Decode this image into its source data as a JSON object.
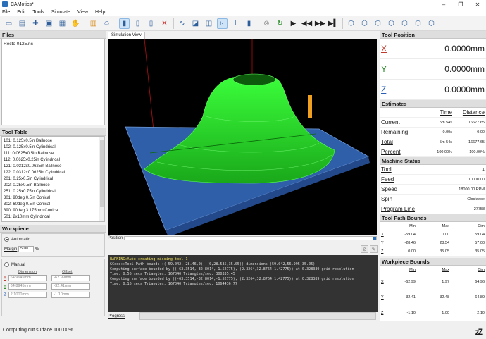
{
  "window": {
    "title": "CAMotics*",
    "controls": [
      "–",
      "❐",
      "✕"
    ]
  },
  "menu": [
    "File",
    "Edit",
    "Tools",
    "Simulate",
    "View",
    "Help"
  ],
  "toolbar": {
    "icons": [
      "new-file",
      "open-file",
      "add",
      "save",
      "export",
      "handshake",
      "tool",
      "user",
      "view-mode-1",
      "view-mode-2",
      "view-mode-3",
      "clear",
      "path",
      "surface",
      "workpiece",
      "axes",
      "tool-display",
      "stop",
      "reload",
      "play",
      "rewind",
      "fast-forward",
      "skip",
      "view-iso",
      "view-front",
      "view-top",
      "view-right",
      "view-back",
      "view-left",
      "view-bottom"
    ]
  },
  "files": {
    "title": "Files",
    "items": [
      "Recto 0125.nc"
    ]
  },
  "tool_table": {
    "title": "Tool Table",
    "items": [
      "101: 0.125x0.5in Ballnose",
      "102: 0.125x0.5in Cylindrical",
      "111: 0.0625x0.5in Ballnose",
      "112: 0.0625x0.25in Cylindrical",
      "121: 0.0312x0.0625in Ballnose",
      "122: 0.0312x0.0625in Cylindrical",
      "201: 0.25x0.5in Cylindrical",
      "202: 0.25x0.5in Ballnose",
      "251: 0.25x0.75in Cylindrical",
      "301: 90deg 0.5in Conical",
      "302: 60deg 0.5in Conical",
      "390: 90deg 3.175mm Conical",
      "501: 2x10mm Cylindrical"
    ]
  },
  "workpiece": {
    "title": "Workpiece",
    "automatic_label": "Automatic",
    "margin_label": "Margin",
    "margin_value": "5.00",
    "margin_unit": "%",
    "manual_label": "Manual",
    "dimension_label": "Dimension",
    "offset_label": "Offset",
    "rows": [
      {
        "axis": "X",
        "dimension": "64.9649mm",
        "offset": "-62.99mm"
      },
      {
        "axis": "Y",
        "dimension": "64.8945mm",
        "offset": "-32.41mm"
      },
      {
        "axis": "Z",
        "dimension": "2.1000mm",
        "offset": "-1.10mm"
      }
    ]
  },
  "simulation": {
    "tab_label": "Simulation View",
    "position_label": "Position"
  },
  "console": {
    "lines": [
      {
        "text": "WARNING:Auto-creating missing tool 1",
        "type": "warn"
      },
      {
        "text": "GCode::Tool Path bounds ((-59.042,-28.46,0), (0,28.535,35.05)) dimensions (59.042,56.995,35.05)",
        "type": "info"
      },
      {
        "text": "Computing surface bounded by ((-63.3514,-32.8014,-1.52775), (2.3264,32.8764,1.42775)) at 0.328389 grid resolution",
        "type": "info"
      },
      {
        "text": "Time: 0.56 secs Triangles: 167040 Triangles/sec: 300335.45",
        "type": "info"
      },
      {
        "text": "Computing surface bounded by ((-63.3514,-32.8014,-1.52775), (2.3264,32.8764,1.42775)) at 0.328389 grid resolution",
        "type": "info"
      },
      {
        "text": "Time: 0.16 secs Triangles: 167040 Triangles/sec: 1064436.77",
        "type": "info"
      }
    ]
  },
  "progress_label": "Progress",
  "status": {
    "text": "Computing cut surface 100.00%",
    "sleep_glyph": "zZ"
  },
  "tool_position": {
    "title": "Tool Position",
    "rows": [
      {
        "axis": "X",
        "value": "0.0000mm"
      },
      {
        "axis": "Y",
        "value": "0.0000mm"
      },
      {
        "axis": "Z",
        "value": "0.0000mm"
      }
    ]
  },
  "estimates": {
    "title": "Estimates",
    "col_time": "Time",
    "col_distance": "Distance",
    "rows": [
      {
        "label": "Current",
        "time": "5m 54s",
        "distance": "16677.65"
      },
      {
        "label": "Remaining",
        "time": "0.00s",
        "distance": "0.00"
      },
      {
        "label": "Total",
        "time": "5m 54s",
        "distance": "16677.65"
      },
      {
        "label": "Percent",
        "time": "100.00%",
        "distance": "100.00%"
      }
    ]
  },
  "machine_status": {
    "title": "Machine Status",
    "rows": [
      {
        "label": "Tool",
        "value": "1"
      },
      {
        "label": "Feed",
        "value": "10000.00"
      },
      {
        "label": "Speed",
        "value": "18000.00 RPM"
      },
      {
        "label": "Spin",
        "value": "Clockwise"
      },
      {
        "label": "Program Line",
        "value": "27758"
      }
    ]
  },
  "tool_path_bounds": {
    "title": "Tool Path Bounds",
    "cols": [
      "Min",
      "Max",
      "Dim"
    ],
    "rows": [
      {
        "axis": "X",
        "min": "-59.04",
        "max": "0.00",
        "dim": "59.04"
      },
      {
        "axis": "Y",
        "min": "-28.46",
        "max": "28.54",
        "dim": "57.00"
      },
      {
        "axis": "Z",
        "min": "0.00",
        "max": "35.05",
        "dim": "35.05"
      }
    ]
  },
  "workpiece_bounds": {
    "title": "Workpiece Bounds",
    "cols": [
      "Min",
      "Max",
      "Dim"
    ],
    "rows": [
      {
        "axis": "X",
        "min": "-62.99",
        "max": "1.97",
        "dim": "64.96"
      },
      {
        "axis": "Y",
        "min": "-32.41",
        "max": "32.48",
        "dim": "64.89"
      },
      {
        "axis": "Z",
        "min": "-1.10",
        "max": "1.00",
        "dim": "2.10"
      }
    ]
  },
  "colors": {
    "accent": "#2a6fb8",
    "toolpath": "#2cff2c",
    "workpiece": "#2f5fa8",
    "tool": "#f0a020",
    "console_bg": "#333333",
    "warn": "#f2e45c"
  }
}
